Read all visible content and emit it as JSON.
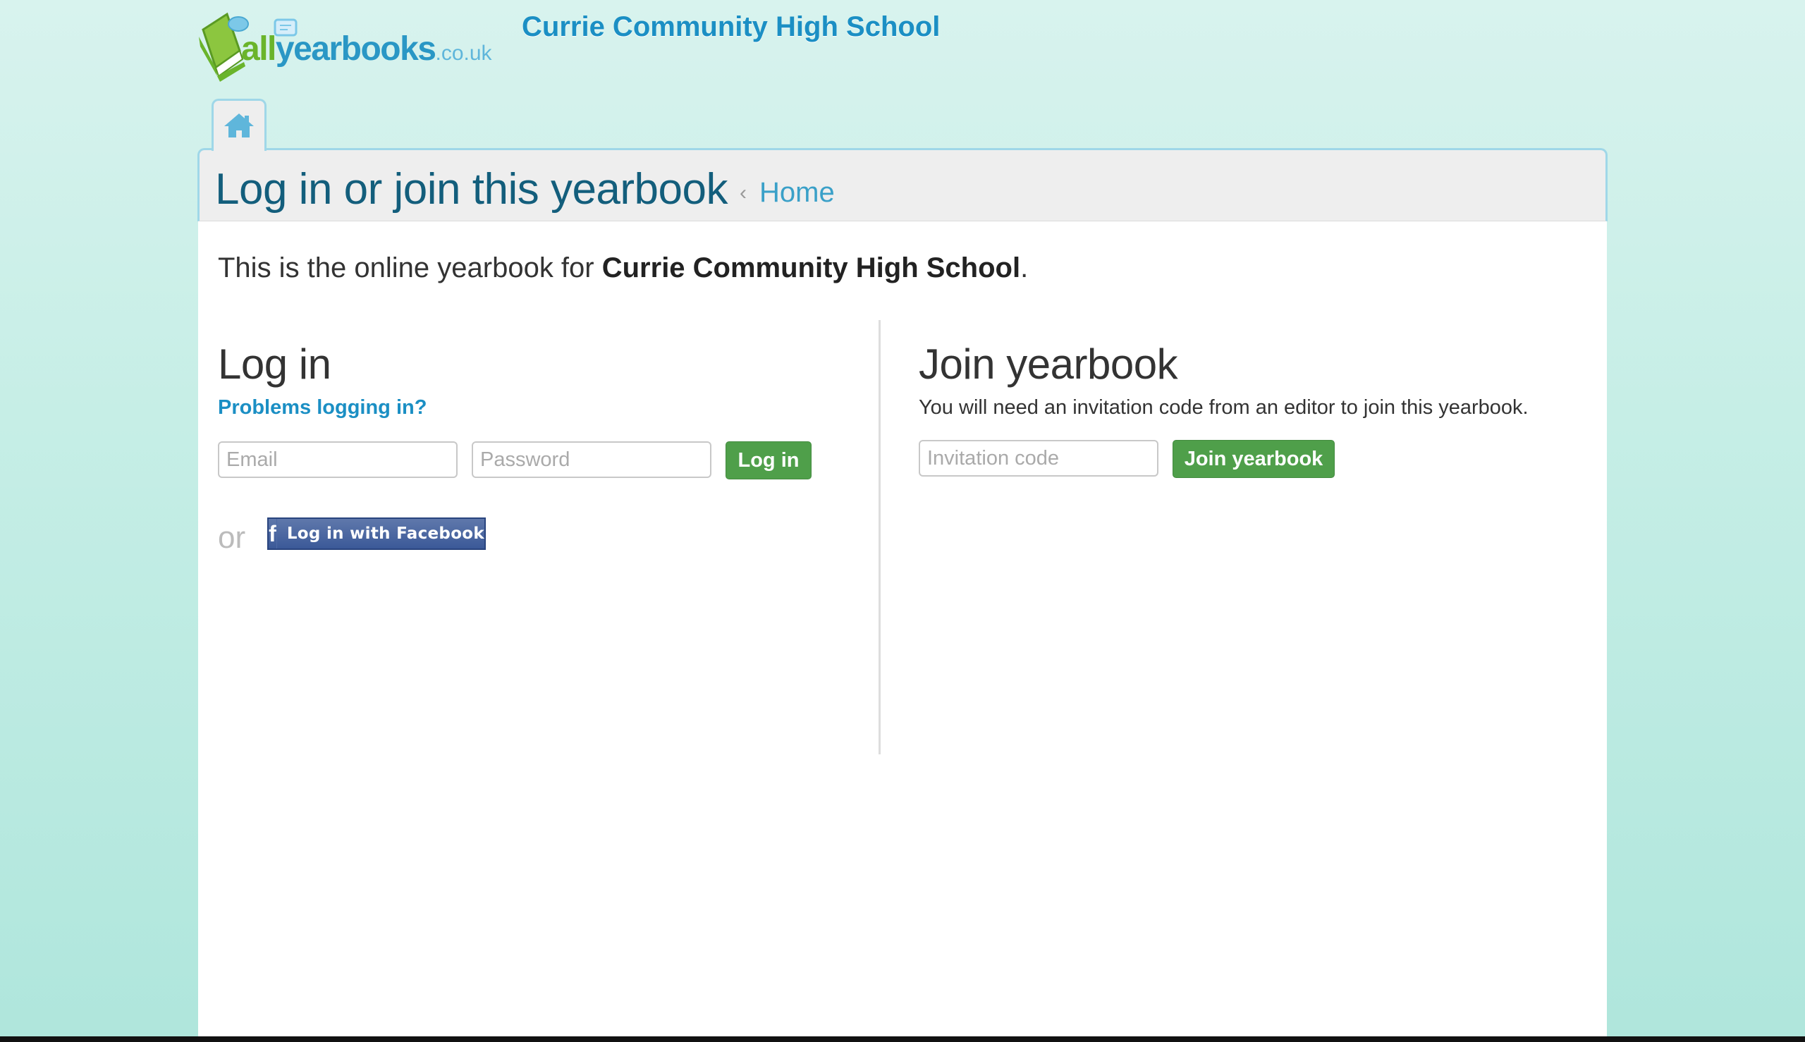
{
  "header": {
    "logo": {
      "all": "all",
      "yearbooks": "yearbooks",
      "tld": ".co.uk"
    },
    "school_title": "Currie Community High School"
  },
  "nav": {
    "home_tab_icon": "home-icon"
  },
  "page": {
    "title": "Log in or join this yearbook",
    "breadcrumb_separator": "‹",
    "breadcrumb_home": "Home"
  },
  "intro": {
    "prefix": "This is the online yearbook for ",
    "school": "Currie Community High School",
    "suffix": "."
  },
  "login": {
    "heading": "Log in",
    "problems_link": "Problems logging in?",
    "email_placeholder": "Email",
    "email_value": "",
    "password_placeholder": "Password",
    "password_value": "",
    "submit_label": "Log in",
    "or_text": "or",
    "facebook_label": "Log in with Facebook",
    "facebook_icon_glyph": "f"
  },
  "join": {
    "heading": "Join yearbook",
    "description": "You will need an invitation code from an editor to join this yearbook.",
    "code_placeholder": "Invitation code",
    "code_value": "",
    "submit_label": "Join yearbook"
  },
  "colors": {
    "background_top": "#d8f3ee",
    "background_bottom": "#afe6dc",
    "brand_blue": "#1b8fc4",
    "brand_green": "#6ab42b",
    "title_blue": "#135e7c",
    "button_green": "#4f9f4a",
    "facebook_blue": "#3b5998",
    "tab_border": "#9fd7e8"
  }
}
